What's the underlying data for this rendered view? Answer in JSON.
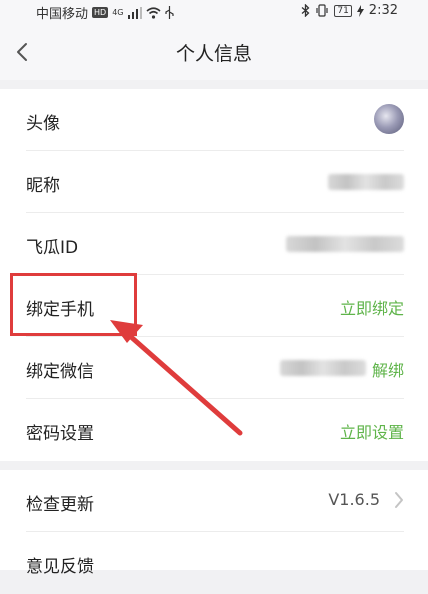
{
  "status_bar": {
    "carrier": "中国移动",
    "hd_badge": "HD",
    "network": "4G",
    "battery": "71",
    "time": "2:32"
  },
  "header": {
    "title": "个人信息"
  },
  "profile": {
    "items": [
      {
        "label": "头像"
      },
      {
        "label": "昵称"
      },
      {
        "label": "飞瓜ID"
      },
      {
        "label": "绑定手机",
        "value": "立即绑定"
      },
      {
        "label": "绑定微信",
        "value": "解绑"
      },
      {
        "label": "密码设置",
        "value": "立即设置"
      }
    ]
  },
  "settings": {
    "items": [
      {
        "label": "检查更新",
        "value": "V1.6.5"
      },
      {
        "label": "意见反馈"
      }
    ]
  },
  "colors": {
    "accent_green": "#5fb44a",
    "annotation_red": "#df3c3c",
    "background": "#f1f1f3"
  }
}
